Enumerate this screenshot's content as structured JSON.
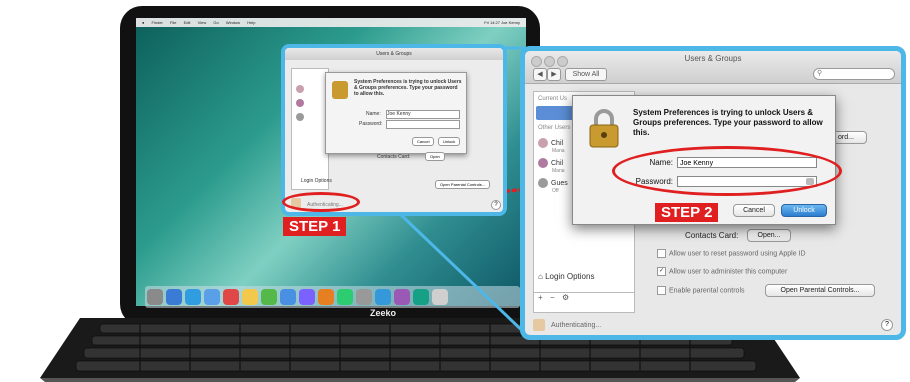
{
  "laptop": {
    "brand": "Zeeko",
    "menubar": {
      "items": [
        "Finder",
        "File",
        "Edit",
        "View",
        "Go",
        "Window",
        "Help"
      ],
      "right_text": "Fri 14:27   Joe Kenny"
    }
  },
  "small_panel": {
    "title": "Users & Groups",
    "dialog": {
      "message": "System Preferences is trying to unlock Users & Groups preferences. Type your password to allow this.",
      "name_label": "Name:",
      "name_value": "Joe Kenny",
      "password_label": "Password:",
      "cancel": "Cancel",
      "unlock": "Unlock"
    },
    "contacts_label": "Contacts Card:",
    "open_label": "Open",
    "login_options": "Login Options",
    "parental_button": "Open Parental Controls...",
    "status": "Authenticating..."
  },
  "big_panel": {
    "title": "Users & Groups",
    "show_all": "Show All",
    "back": "◀",
    "forward": "▶",
    "sidebar": {
      "current_header": "Current Us",
      "other_header": "Other Users",
      "users": [
        {
          "name": "Chil",
          "sub": "Mana",
          "color": "#c9a0b0"
        },
        {
          "name": "Chil",
          "sub": "Mana",
          "color": "#b07aa0"
        },
        {
          "name": "Gues",
          "sub": "Off",
          "color": "#9a9a9a"
        }
      ],
      "login_options": "Login Options",
      "add": "+",
      "remove": "−",
      "gear": "⚙"
    },
    "dialog": {
      "message": "System Preferences is trying to unlock Users & Groups preferences. Type your password to allow this.",
      "name_label": "Name:",
      "name_value": "Joe Kenny",
      "password_label": "Password:",
      "cancel": "Cancel",
      "unlock": "Unlock",
      "hint_button": "ord..."
    },
    "contacts_label": "Contacts Card:",
    "open_label": "Open...",
    "options": {
      "reset_password": "Allow user to reset password using Apple ID",
      "administer": "Allow user to administer this computer",
      "parental": "Enable parental controls"
    },
    "parental_button": "Open Parental Controls...",
    "status": "Authenticating...",
    "help": "?"
  },
  "annotations": {
    "step1": "STEP 1",
    "step2": "STEP 2"
  },
  "colors": {
    "accent_blue": "#4db8e8",
    "annotation_red": "#e02020"
  }
}
